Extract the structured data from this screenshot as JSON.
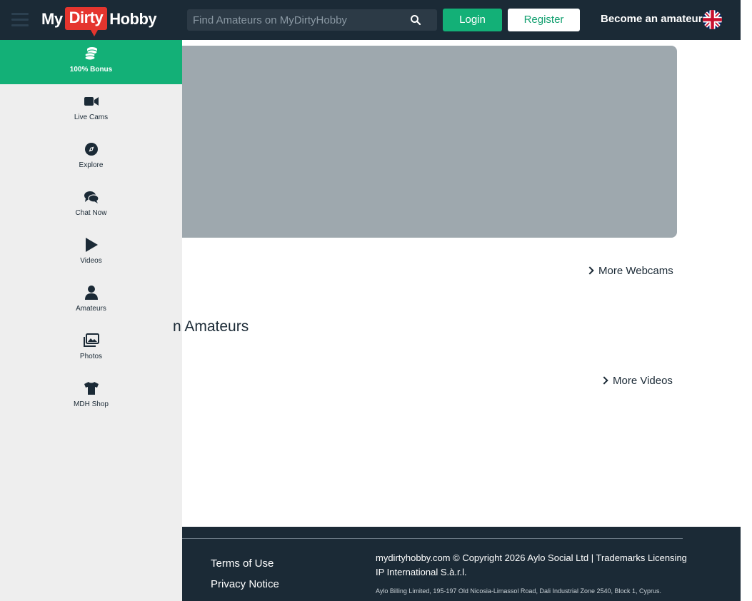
{
  "header": {
    "logo": {
      "my": "My",
      "dirty": "Dirty",
      "hobby": "Hobby"
    },
    "search_placeholder": "Find Amateurs on MyDirtyHobby",
    "login_label": "Login",
    "register_label": "Register",
    "become_label": "Become an amateur",
    "language_icon": "uk-flag-icon"
  },
  "sidebar": {
    "items": [
      {
        "label": "100% Bonus",
        "icon": "coins-icon"
      },
      {
        "label": "Live Cams",
        "icon": "video-camera-icon"
      },
      {
        "label": "Explore",
        "icon": "compass-icon"
      },
      {
        "label": "Chat Now",
        "icon": "chat-bubbles-icon"
      },
      {
        "label": "Videos",
        "icon": "play-icon"
      },
      {
        "label": "Amateurs",
        "icon": "user-icon"
      },
      {
        "label": "Photos",
        "icon": "photos-icon"
      },
      {
        "label": "MDH Shop",
        "icon": "tshirt-icon"
      }
    ]
  },
  "main": {
    "more_webcams": "More Webcams",
    "section_title": "n Amateurs",
    "more_videos": "More Videos"
  },
  "footer": {
    "links": [
      "Terms of Use",
      "Privacy Notice"
    ],
    "copyright": "mydirtyhobby.com © Copyright 2026 Aylo Social Ltd | Trademarks Licensing IP International S.à.r.l.",
    "billing": "Aylo Billing Limited, 195-197 Old Nicosia-Limassol Road, Dali Industrial Zone 2540, Block 1, Cyprus."
  },
  "colors": {
    "header_bg": "#1b2a36",
    "accent_green": "#13b077",
    "logo_red": "#e5352e",
    "sidebar_bg": "#eeeeee",
    "hero_placeholder": "#9ea8ae"
  }
}
